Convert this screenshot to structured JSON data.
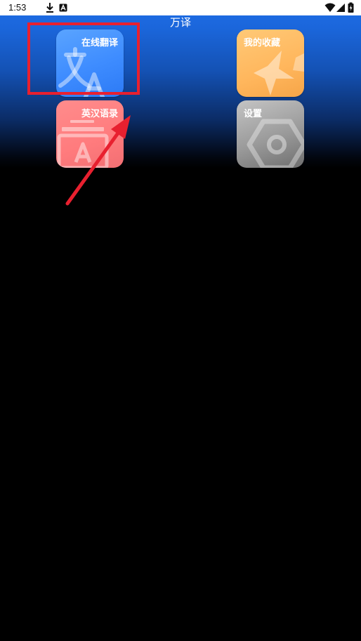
{
  "status_bar": {
    "time": "1:53",
    "left_icons": [
      "download-icon",
      "a-badge-icon"
    ],
    "right_icons": [
      "wifi-icon",
      "signal-icon",
      "battery-icon"
    ]
  },
  "app": {
    "title": "万译"
  },
  "tiles": [
    {
      "id": "translate",
      "label": "在线翻译",
      "icon": "translate-icon",
      "color": "#3e8cff"
    },
    {
      "id": "favorites",
      "label": "我的收藏",
      "icon": "star-icon",
      "color": "#ffb65c"
    },
    {
      "id": "quotes",
      "label": "英汉语录",
      "icon": "book-icon",
      "color": "#ff7b7d"
    },
    {
      "id": "settings",
      "label": "设置",
      "icon": "gear-icon",
      "color": "#9a9a9a"
    }
  ],
  "annotation": {
    "highlight_color": "#e8202f"
  }
}
